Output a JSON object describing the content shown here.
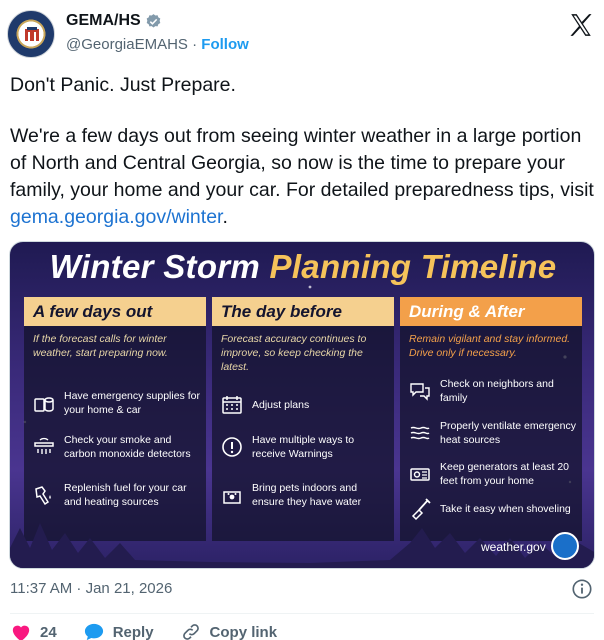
{
  "author": {
    "display_name": "GEMA/HS",
    "handle": "@GeorgiaEMAHS",
    "separator": "·",
    "follow_label": "Follow"
  },
  "tweet": {
    "line1": "Don't Panic. Just Prepare.",
    "body": "We're a few days out from seeing winter weather in a large portion of North and Central Georgia, so now is the time to prepare your family, your home and your car. For detailed preparedness tips, visit ",
    "link": "gema.georgia.gov/winter",
    "end": "."
  },
  "card": {
    "title_part1": "Winter Storm ",
    "title_part2": "Planning Timeline",
    "columns": [
      {
        "heading": "A few days out",
        "intro": "If the forecast calls for winter weather, start preparing now.",
        "items": [
          {
            "label": "Have emergency supplies for your home & car",
            "icon": "supplies-icon"
          },
          {
            "label": "Check your smoke and carbon monoxide detectors",
            "icon": "smoke-detector-icon"
          },
          {
            "label": "Replenish fuel for your car and heating sources",
            "icon": "fuel-nozzle-icon"
          }
        ]
      },
      {
        "heading": "The day before",
        "intro": "Forecast accuracy continues to improve, so keep checking the latest.",
        "items": [
          {
            "label": "Adjust plans",
            "icon": "calendar-icon"
          },
          {
            "label": "Have multiple ways to receive Warnings",
            "icon": "warning-icon"
          },
          {
            "label": "Bring pets indoors and ensure they have water",
            "icon": "pet-icon"
          }
        ]
      },
      {
        "heading": "During & After",
        "intro": "Remain vigilant and stay informed. Drive only if necessary.",
        "items": [
          {
            "label": "Check on neighbors and family",
            "icon": "chat-icon"
          },
          {
            "label": "Properly ventilate emergency heat sources",
            "icon": "ventilation-icon"
          },
          {
            "label": "Keep generators at least 20 feet from your home",
            "icon": "generator-icon"
          },
          {
            "label": "Take it easy when shoveling",
            "icon": "shovel-icon"
          }
        ]
      }
    ],
    "source": "weather.gov"
  },
  "meta": {
    "timestamp": "11:37 AM · Jan 21, 2026"
  },
  "actions": {
    "likes": "24",
    "reply_label": "Reply",
    "copy_label": "Copy link"
  },
  "colors": {
    "link": "#1d73d1",
    "follow": "#1d9bf0",
    "like": "#f91880",
    "reply": "#1d9bf0",
    "card_heading": "#f5d08f",
    "card_heading_alt": "#f3a04a"
  }
}
